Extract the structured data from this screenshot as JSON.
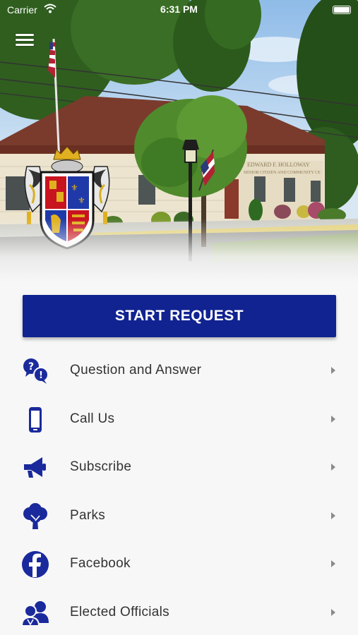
{
  "status_bar": {
    "carrier": "Carrier",
    "time": "6:31 PM"
  },
  "hero": {
    "building_sign": "EDWARD F. HOLLOWAY",
    "building_sign_line2": "SENIOR CITIZEN AND COMMUNITY CE"
  },
  "start_button": {
    "label": "START REQUEST"
  },
  "menu": {
    "items": [
      {
        "label": "Question and Answer",
        "icon": "question-answer-icon"
      },
      {
        "label": "Call Us",
        "icon": "phone-icon"
      },
      {
        "label": "Subscribe",
        "icon": "megaphone-icon"
      },
      {
        "label": "Parks",
        "icon": "tree-icon"
      },
      {
        "label": "Facebook",
        "icon": "facebook-icon"
      },
      {
        "label": "Elected Officials",
        "icon": "officials-icon"
      }
    ]
  },
  "colors": {
    "accent": "#112391",
    "icon": "#1a2a9c",
    "text": "#333333",
    "background": "#f7f7f7"
  }
}
